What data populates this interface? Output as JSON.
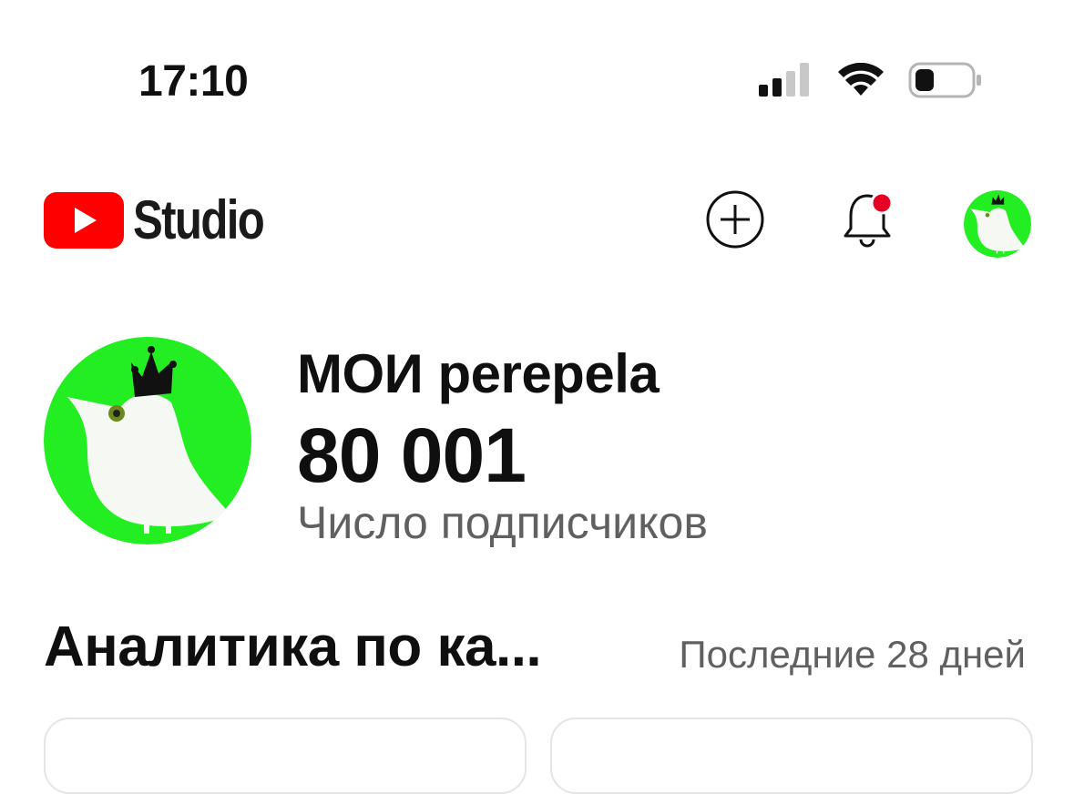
{
  "status_bar": {
    "time": "17:10",
    "icons": [
      "cellular-signal-icon",
      "wifi-icon",
      "battery-icon"
    ]
  },
  "app_bar": {
    "logo_text": "Studio",
    "logo_icon": "youtube-play-icon",
    "actions": [
      "create-plus-icon",
      "notification-bell-icon",
      "account-avatar"
    ],
    "notification_dot": true
  },
  "channel": {
    "name": "МОИ perepela",
    "subscribers": "80 001",
    "subscribers_label": "Число подписчиков"
  },
  "analytics": {
    "title": "Аналитика по ка...",
    "period": "Последние 28 дней"
  },
  "colors": {
    "youtube_red": "#ff0000",
    "avatar_green": "#22ee22",
    "notification_red": "#e60023",
    "secondary_text": "#606060"
  }
}
